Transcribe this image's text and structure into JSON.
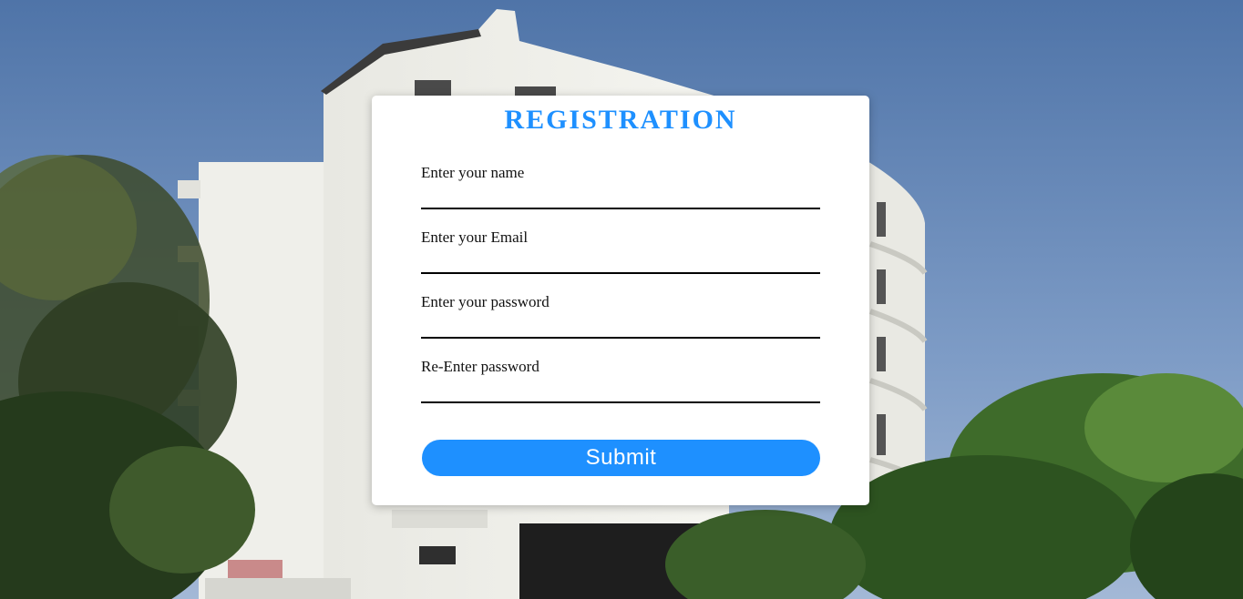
{
  "form": {
    "title": "REGISTRATION",
    "fields": [
      {
        "label": "Enter your name",
        "value": "",
        "type": "text"
      },
      {
        "label": "Enter your Email",
        "value": "",
        "type": "email"
      },
      {
        "label": "Enter your password",
        "value": "",
        "type": "password"
      },
      {
        "label": "Re-Enter password",
        "value": "",
        "type": "password"
      }
    ],
    "submit_label": "Submit"
  },
  "colors": {
    "accent": "#1e90ff",
    "card_bg": "#ffffff",
    "sky": "#6d8db8"
  }
}
